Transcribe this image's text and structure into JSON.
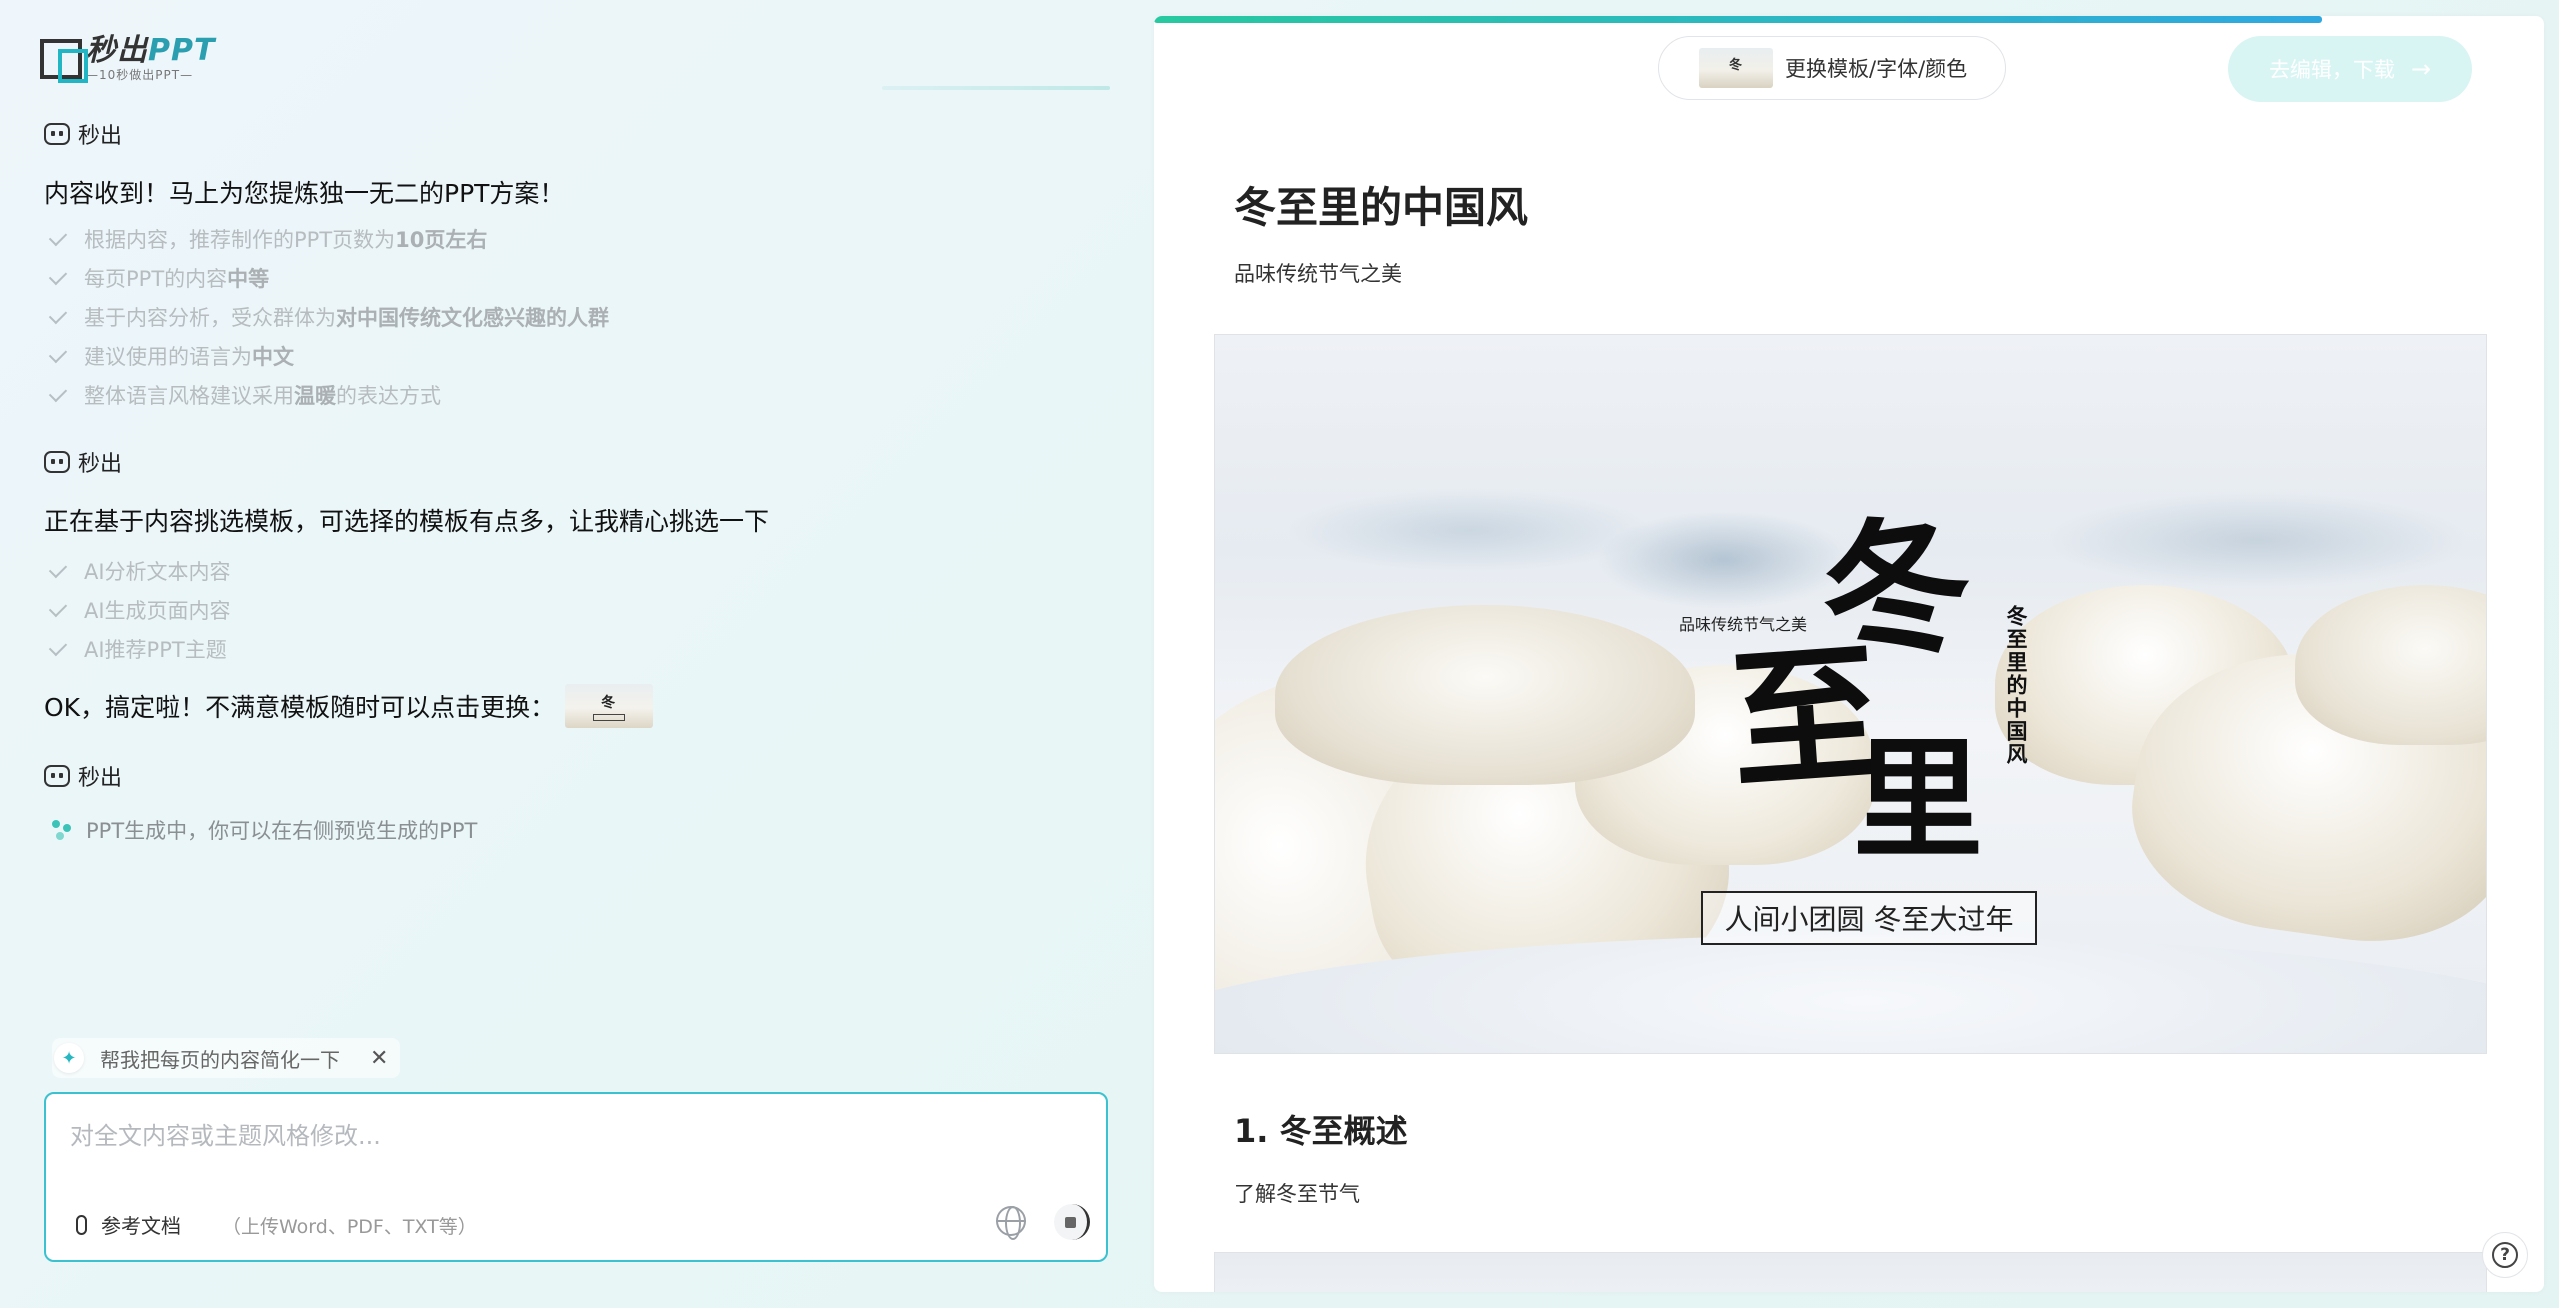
{
  "logo": {
    "name_part1": "秒出",
    "name_part2": "PPT",
    "tagline": "—10秒做出PPT—"
  },
  "chat": {
    "sender": "秒出",
    "msg1": "内容收到！马上为您提炼独一无二的PPT方案！",
    "steps1": [
      {
        "prefix": "根据内容，推荐制作的PPT页数为 ",
        "bold": "10页左右",
        "suffix": ""
      },
      {
        "prefix": "每页PPT的内容 ",
        "bold": "中等",
        "suffix": ""
      },
      {
        "prefix": "基于内容分析，受众群体为 ",
        "bold": "对中国传统文化感兴趣的人群",
        "suffix": ""
      },
      {
        "prefix": "建议使用的语言为 ",
        "bold": "中文",
        "suffix": ""
      },
      {
        "prefix": "整体语言风格建议采用 ",
        "bold": "温暖",
        "suffix": " 的表达方式"
      }
    ],
    "msg2": "正在基于内容挑选模板，可选择的模板有点多，让我精心挑选一下",
    "steps2": [
      "AI分析文本内容",
      "AI生成页面内容",
      "AI推荐PPT主题"
    ],
    "msg3": "OK，搞定啦！不满意模板随时可以点击更换：",
    "generating": "PPT生成中，你可以在右侧预览生成的PPT"
  },
  "suggestion": {
    "text": "帮我把每页的内容简化一下",
    "close": "✕"
  },
  "input": {
    "placeholder": "对全文内容或主题风格修改...",
    "attach_label": "参考文档",
    "attach_hint": "（上传Word、PDF、TXT等）"
  },
  "preview": {
    "progress_percent": 84,
    "template_button": "更换模板/字体/颜色",
    "download_button": "去编辑，下载",
    "doc_title": "冬至里的中国风",
    "doc_subtitle": "品味传统节气之美",
    "slide": {
      "small_text": "品味传统节气之美",
      "char1": "冬",
      "char2": "至",
      "char3": "里",
      "vertical_title": "冬至里的中国风",
      "box_text": "人间小团圆 冬至大过年"
    },
    "section1_title": "1. 冬至概述",
    "section1_sub": "了解冬至节气"
  },
  "help": "?",
  "colors": {
    "accent": "#3bc1cf",
    "progress_start": "#28c8a0",
    "progress_end": "#2fa8e0"
  }
}
